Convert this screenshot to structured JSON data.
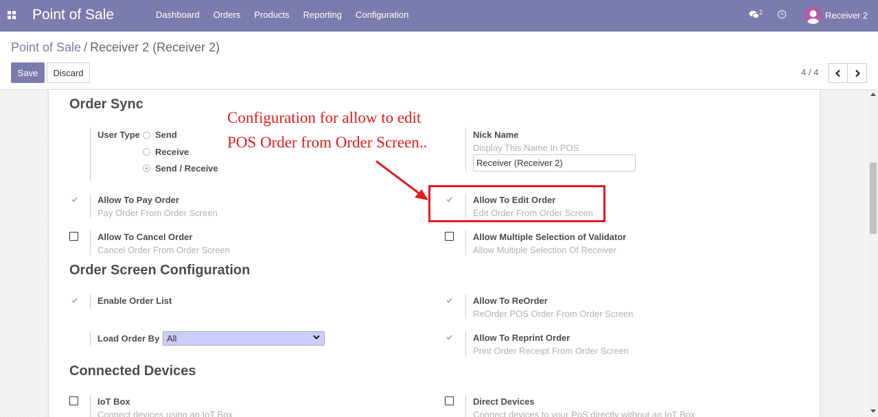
{
  "navbar": {
    "brand": "Point of Sale",
    "menu": [
      "Dashboard",
      "Orders",
      "Products",
      "Reporting",
      "Configuration"
    ],
    "chat_count": "2",
    "user_name": "Receiver 2"
  },
  "breadcrumb": {
    "parent": "Point of Sale",
    "separator": "/",
    "current": "Receiver 2 (Receiver 2)"
  },
  "toolbar": {
    "save_label": "Save",
    "discard_label": "Discard"
  },
  "pager": {
    "text": "4 / 4"
  },
  "order_sync": {
    "title": "Order Sync",
    "user_type_label": "User Type",
    "user_type_options": [
      "Send",
      "Receive",
      "Send / Receive"
    ],
    "user_type_selected": "Send / Receive",
    "nick_name_label": "Nick Name",
    "nick_name_help": "Display This Name In POS",
    "nick_name_value": "Receiver (Receiver 2)",
    "allow_pay_label": "Allow To Pay Order",
    "allow_pay_help": "Pay Order From Order Screen",
    "allow_edit_label": "Allow To Edit Order",
    "allow_edit_help": "Edit Order From Order Screen",
    "allow_cancel_label": "Allow To Cancel Order",
    "allow_cancel_help": "Cancel Order From Order Screen",
    "allow_multi_label": "Allow Multiple Selection of Validator",
    "allow_multi_help": "Allow Multiple Selection Of Receiver"
  },
  "order_screen": {
    "title": "Order Screen Configuration",
    "enable_list_label": "Enable Order List",
    "reorder_label": "Allow To ReOrder",
    "reorder_help": "ReOrder POS Order From Order Screen",
    "load_by_label": "Load Order By",
    "load_by_value": "All",
    "reprint_label": "Allow To Reprint Order",
    "reprint_help": "Print Order Receipt From Order Screen"
  },
  "devices": {
    "title": "Connected Devices",
    "iot_label": "IoT Box",
    "iot_help": "Connect devices using an IoT Box",
    "direct_label": "Direct Devices",
    "direct_help": "Connect devices to your PoS directly without an IoT Box"
  },
  "annotation": {
    "line1": "Configuration for allow to edit",
    "line2": "POS Order from Order Screen..",
    "color": "#e01b1b"
  },
  "colors": {
    "brand": "#7c7bad",
    "highlight": "#e8171c"
  }
}
